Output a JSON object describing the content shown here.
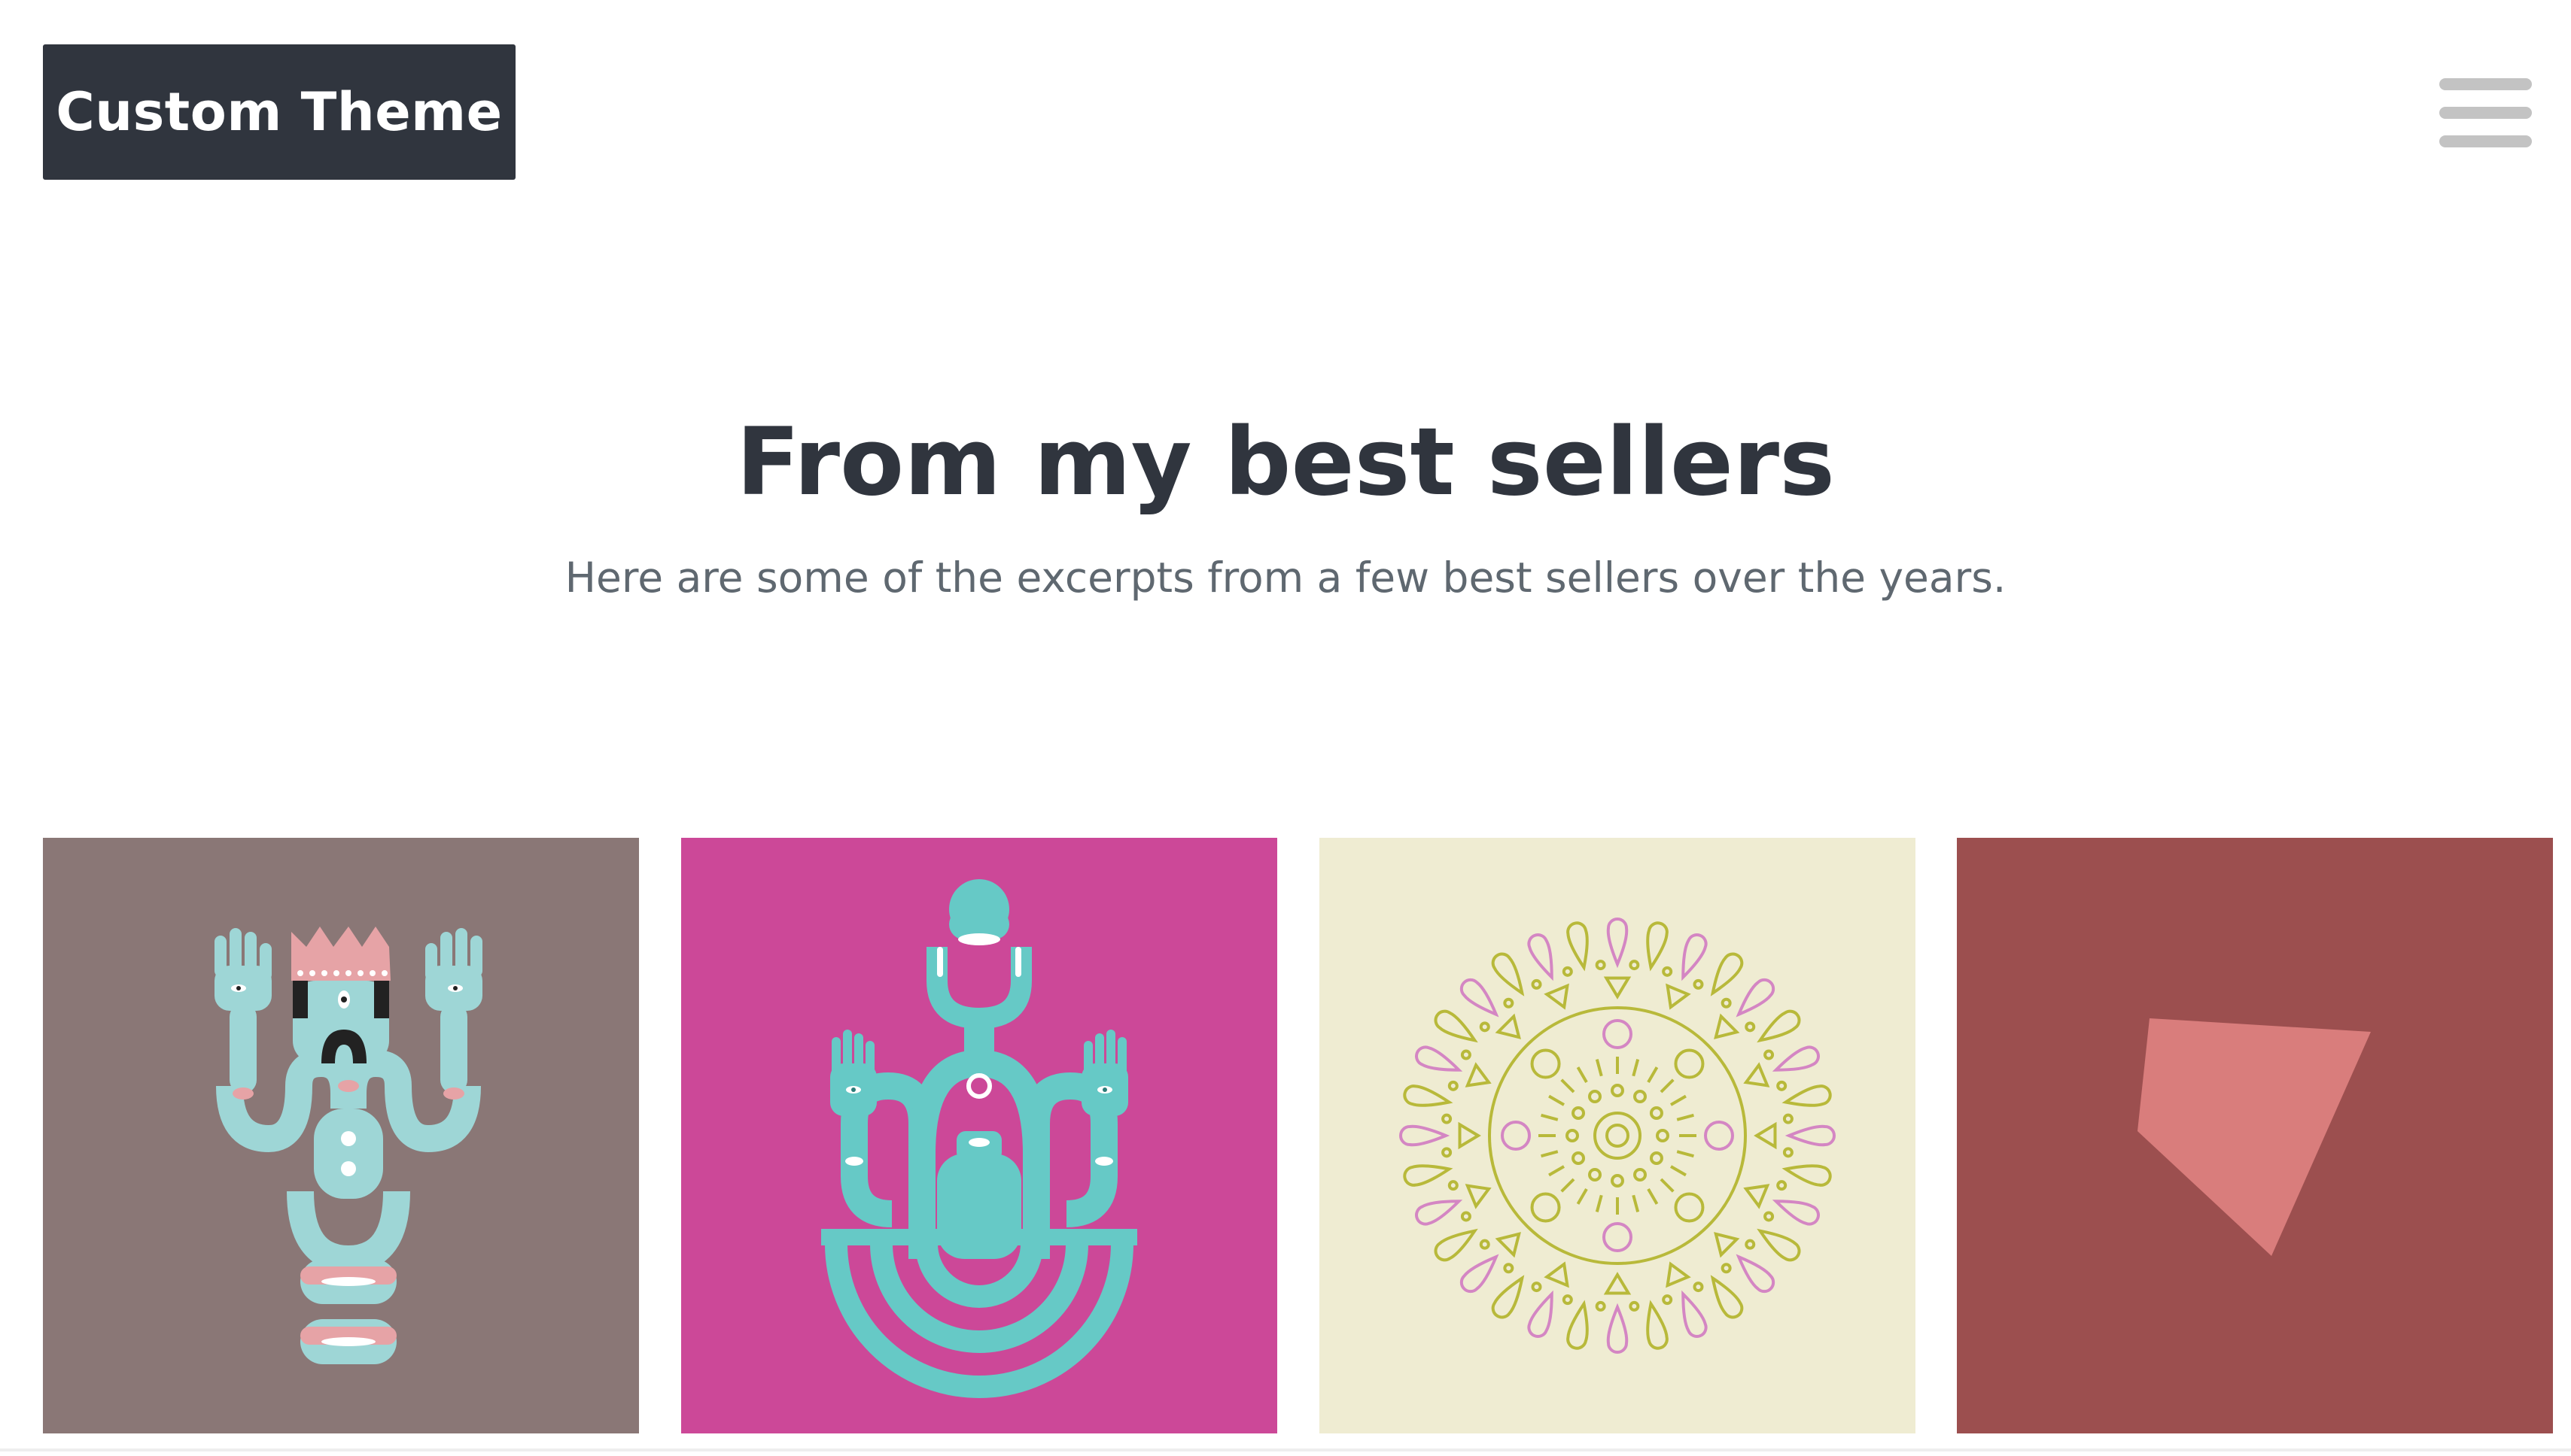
{
  "header": {
    "brand_label": "Custom Theme",
    "brand_bg": "#30353e",
    "menu_icon": "hamburger-menu-icon"
  },
  "section": {
    "title": "From my best sellers",
    "subtitle": "Here are some of the excerpts from a few best sellers over the years."
  },
  "gallery": {
    "tiles": [
      {
        "name": "king-figure-illustration",
        "background": "#8a7776"
      },
      {
        "name": "totem-figure-illustration",
        "background": "#cc4898"
      },
      {
        "name": "mandala-illustration",
        "background": "#efecd2"
      },
      {
        "name": "polygon-illustration",
        "background": "#9c4f4f"
      }
    ]
  },
  "colors": {
    "accent_teal": "#6ecdc9",
    "accent_pink": "#e49ca0",
    "mandala_green": "#b8b93a",
    "mandala_pink": "#d486c3",
    "heading": "#30353e",
    "subtext": "#5f6870"
  }
}
